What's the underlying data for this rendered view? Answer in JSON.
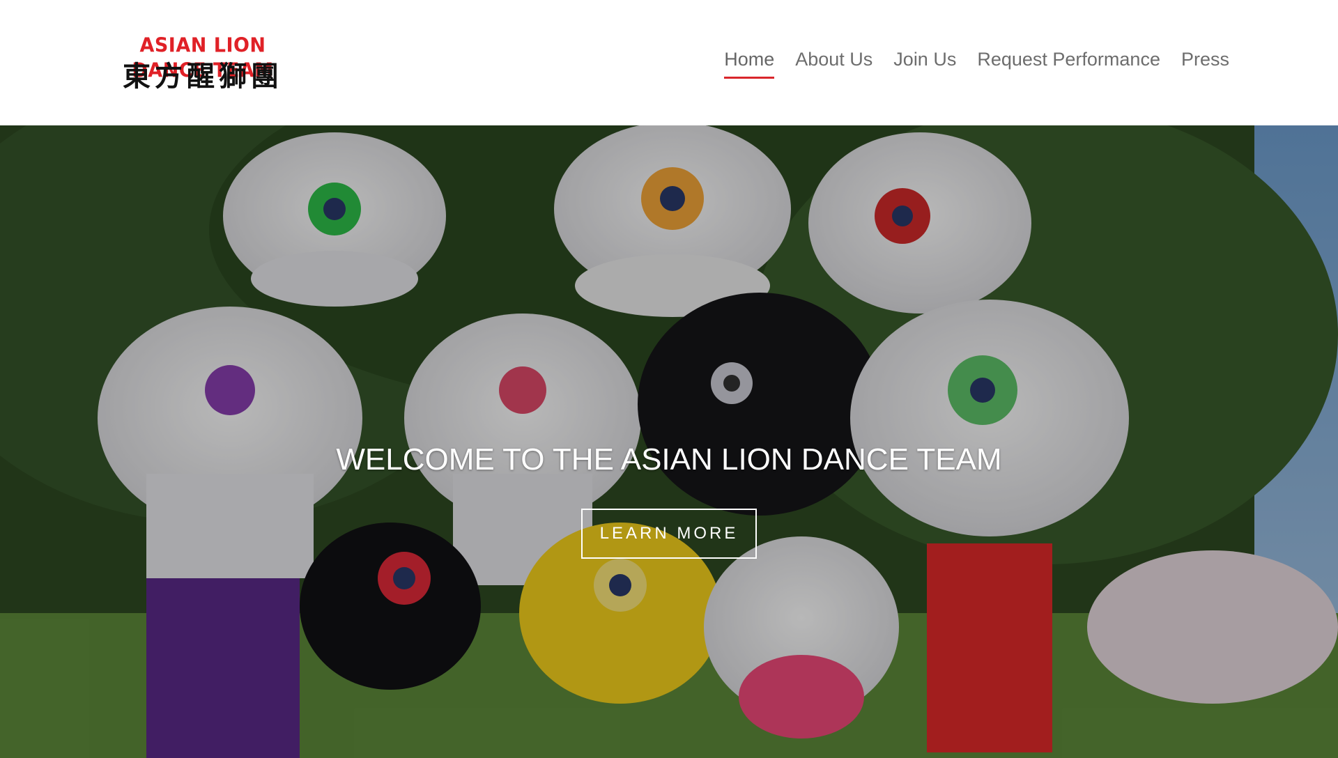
{
  "logo": {
    "text_en": "ASIAN LION DANCE TEAM",
    "text_cn": "東方醒獅團"
  },
  "nav": {
    "items": [
      {
        "label": "Home",
        "active": true
      },
      {
        "label": "About Us"
      },
      {
        "label": "Join Us"
      },
      {
        "label": "Request Performance"
      },
      {
        "label": "Press"
      }
    ]
  },
  "hero": {
    "title": "WELCOME TO THE ASIAN LION DANCE TEAM",
    "button_label": "LEARN MORE"
  },
  "colors": {
    "accent": "#d9262b",
    "nav_text": "#6d6d6d"
  }
}
